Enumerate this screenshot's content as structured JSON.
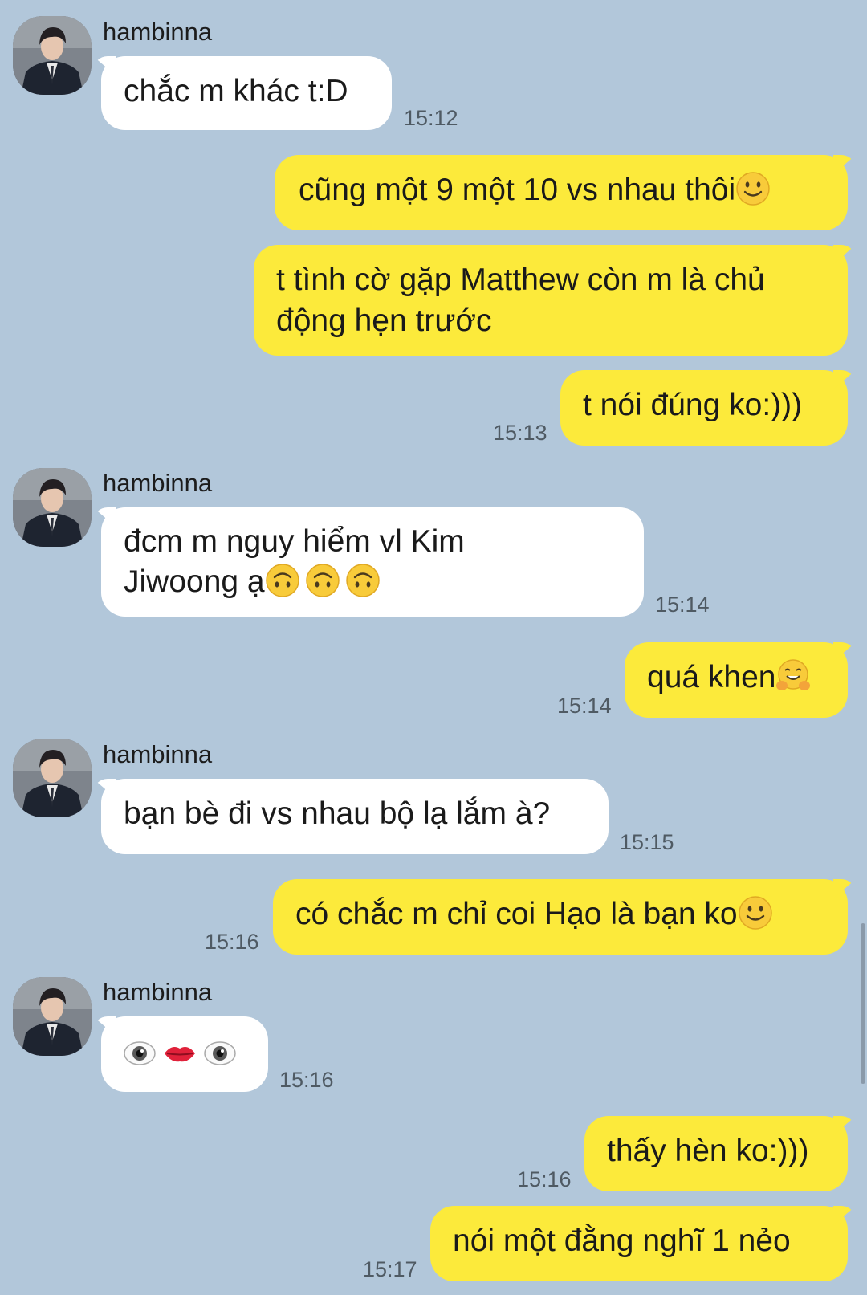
{
  "contact": {
    "name": "hambinna"
  },
  "messages": [
    {
      "id": 1,
      "dir": "in",
      "text": "chắc m khác t:D",
      "time": "15:12"
    },
    {
      "id": 2,
      "dir": "out",
      "text": "cũng một 9 một 10 vs nhau thôi",
      "emoji": "slightly-smiling-face"
    },
    {
      "id": 3,
      "dir": "out",
      "line1": "t tình cờ gặp Matthew còn m là chủ",
      "line2": "động hẹn trước"
    },
    {
      "id": 4,
      "dir": "out",
      "text": "t nói đúng ko:)))",
      "time": "15:13"
    },
    {
      "id": 5,
      "dir": "in",
      "line1": "đcm m nguy hiểm vl Kim",
      "line2": "Jiwoong ạ",
      "emoji": "upside-down-face x3",
      "time": "15:14"
    },
    {
      "id": 6,
      "dir": "out",
      "text": "quá khen",
      "emoji": "hugging-face",
      "time": "15:14"
    },
    {
      "id": 7,
      "dir": "in",
      "text": "bạn bè đi vs nhau bộ lạ lắm à?",
      "time": "15:15"
    },
    {
      "id": 8,
      "dir": "out",
      "text": "có chắc m chỉ coi Hạo là bạn ko",
      "emoji": "slightly-smiling-face",
      "time": "15:16"
    },
    {
      "id": 9,
      "dir": "in",
      "emoji": "eye lips eye",
      "time": "15:16"
    },
    {
      "id": 10,
      "dir": "out",
      "text": "thấy hèn ko:)))",
      "time": "15:16"
    },
    {
      "id": 11,
      "dir": "out",
      "text": "nói một đằng nghĩ 1 nẻo",
      "time": "15:17"
    }
  ],
  "colors": {
    "background": "#b2c7da",
    "incoming": "#ffffff",
    "outgoing": "#fcea3b"
  }
}
